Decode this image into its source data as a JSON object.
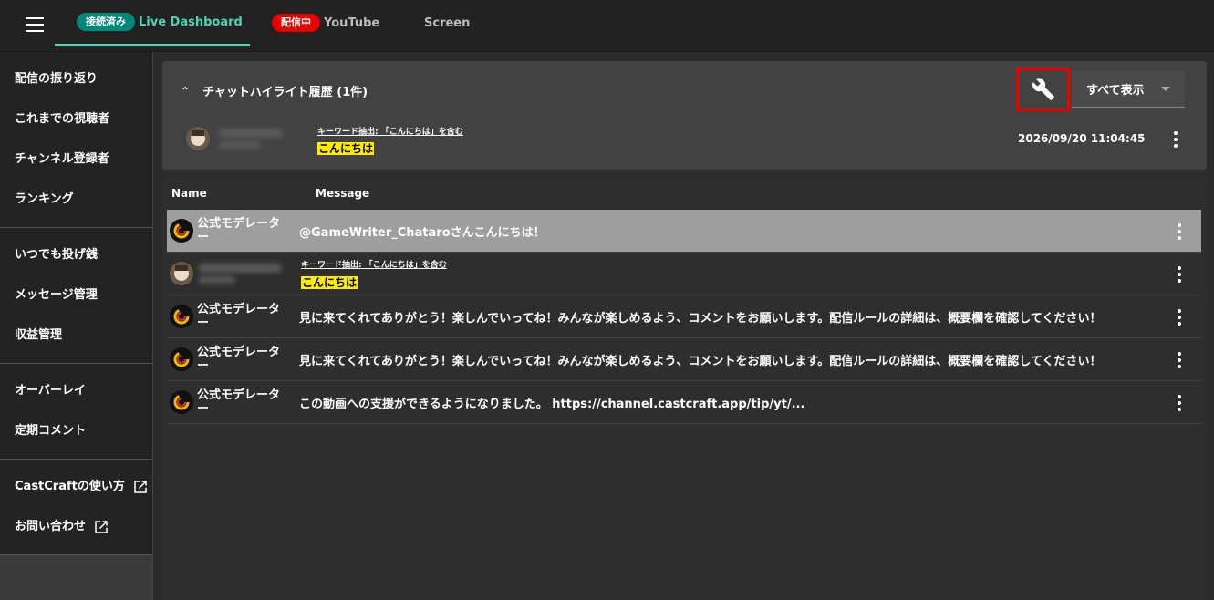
{
  "topbar": {
    "tabs": [
      {
        "badge": "接続済み",
        "badge_color": "#00897b",
        "label": "Live Dashboard",
        "label_color": "#4dd6b5"
      },
      {
        "badge": "配信中",
        "badge_color": "#e60000",
        "label": "YouTube",
        "label_color": "#bbbbbb"
      },
      {
        "badge": "",
        "label": "Screen",
        "label_color": "#bbbbbb"
      }
    ]
  },
  "sidebar": {
    "group1": [
      "配信の振り返り",
      "これまでの視聴者",
      "チャンネル登録者",
      "ランキング"
    ],
    "group2": [
      "いつでも投げ銭",
      "メッセージ管理",
      "収益管理"
    ],
    "group3": [
      "オーバーレイ",
      "定期コメント"
    ],
    "group4": [
      "CastCraftの使い方",
      "お問い合わせ"
    ]
  },
  "highlight": {
    "title": "チャットハイライト履歴 (1件)",
    "select_value": "すべて表示",
    "keyword": "キーワード抽出: 「こんにちは」を含む",
    "message": "こんにちは",
    "timestamp": "2026/09/20 11:04:45"
  },
  "table": {
    "headers": {
      "name": "Name",
      "message": "Message"
    },
    "rows": [
      {
        "name": "公式モデレーター",
        "message": "@GameWriter_Chataroさんこんにちは！",
        "selected": true
      },
      {
        "name": "",
        "keyword": "キーワード抽出: 「こんにちは」を含む",
        "message": "こんにちは",
        "blurred": true
      },
      {
        "name": "公式モデレーター",
        "message": "見に来てくれてありがとう！楽しんでいってね！みんなが楽しめるよう、コメントをお願いします。配信ルールの詳細は、概要欄を確認してください！"
      },
      {
        "name": "公式モデレーター",
        "message": "見に来てくれてありがとう！楽しんでいってね！みんなが楽しめるよう、コメントをお願いします。配信ルールの詳細は、概要欄を確認してください！"
      },
      {
        "name": "公式モデレーター",
        "message": "この動画への支援ができるようになりました。 https://channel.castcraft.app/tip/yt/..."
      }
    ]
  }
}
